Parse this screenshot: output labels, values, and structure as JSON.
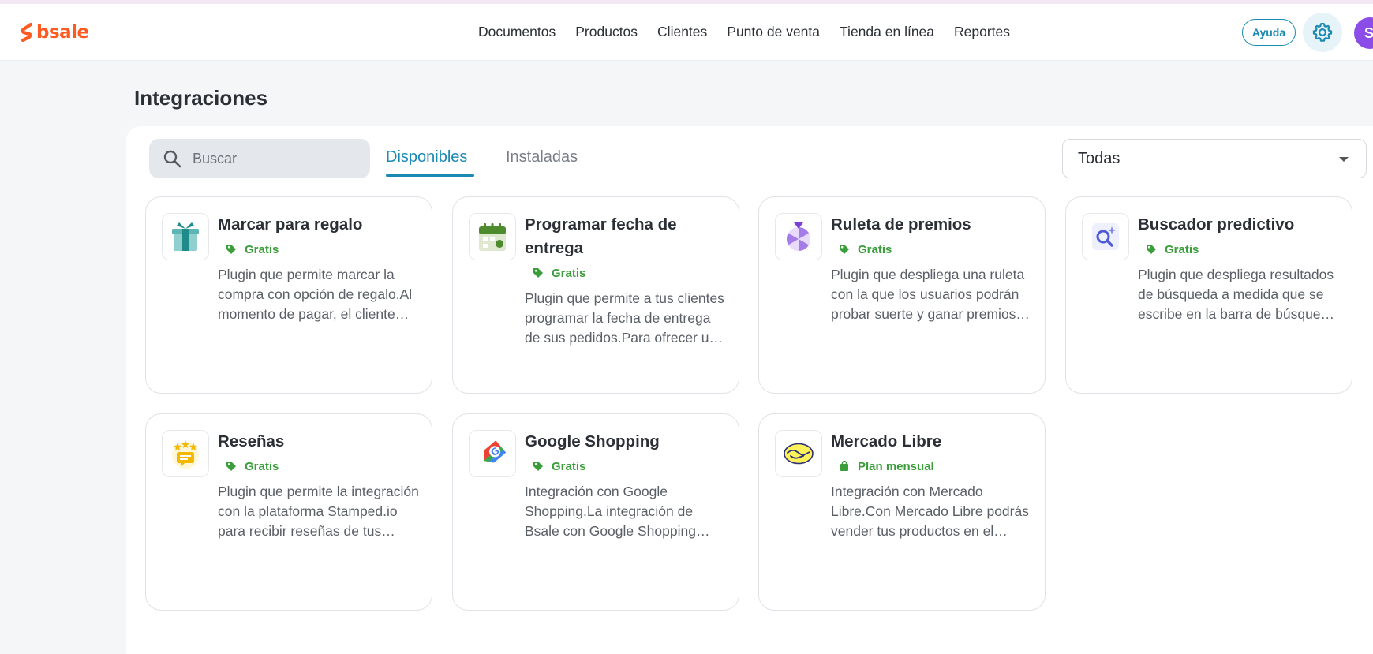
{
  "brand": {
    "logo_text": "bsale",
    "color": "#ff5a1f"
  },
  "nav": [
    {
      "label": "Documentos"
    },
    {
      "label": "Productos"
    },
    {
      "label": "Clientes"
    },
    {
      "label": "Punto de venta"
    },
    {
      "label": "Tienda en línea"
    },
    {
      "label": "Reportes"
    }
  ],
  "header": {
    "help_label": "Ayuda",
    "settings_icon": "gear-icon",
    "avatar_initial": "S"
  },
  "page": {
    "title": "Integraciones"
  },
  "search": {
    "placeholder": "Buscar",
    "value": ""
  },
  "tabs": [
    {
      "label": "Disponibles",
      "active": true
    },
    {
      "label": "Instaladas",
      "active": false
    }
  ],
  "filter": {
    "selected": "Todas"
  },
  "accent_color": "#1b8ab3",
  "price_color": "#3a9e3a",
  "cards": [
    {
      "title": "Marcar para regalo",
      "price": "Gratis",
      "price_icon": "tag-icon",
      "icon": "gift-icon",
      "description": "Plugin que permite marcar la compra con opción de regalo.Al momento de pagar, el cliente podrá indicar si desea que su compra sea enviada como regalo."
    },
    {
      "title": "Programar fecha de entrega",
      "price": "Gratis",
      "price_icon": "tag-icon",
      "icon": "calendar-icon",
      "description": "Plugin que permite a tus clientes programar la fecha de entrega de sus pedidos.Para ofrecer una mejor experiencia de compra."
    },
    {
      "title": "Ruleta de premios",
      "price": "Gratis",
      "price_icon": "tag-icon",
      "icon": "roulette-icon",
      "description": "Plugin que despliega una ruleta con la que los usuarios podrán probar suerte y ganar premios y descuentos."
    },
    {
      "title": "Buscador predictivo",
      "price": "Gratis",
      "price_icon": "tag-icon",
      "icon": "search-sparkle-icon",
      "description": "Plugin que despliega resultados de búsqueda a medida que se escribe en la barra de búsqueda de la tienda."
    },
    {
      "title": "Reseñas",
      "price": "Gratis",
      "price_icon": "tag-icon",
      "icon": "reviews-icon",
      "description": "Plugin que permite la integración con la plataforma Stamped.io para recibir reseñas de tus productos."
    },
    {
      "title": "Google Shopping",
      "price": "Gratis",
      "price_icon": "tag-icon",
      "icon": "google-shopping-icon",
      "description": "Integración con Google Shopping.La integración de Bsale con Google Shopping permite publicar tus productos."
    },
    {
      "title": "Mercado Libre",
      "price": "Plan mensual",
      "price_icon": "bag-icon",
      "icon": "mercado-libre-icon",
      "description": "Integración con Mercado Libre.Con Mercado Libre podrás vender tus productos en el marketplace más grande de la región."
    }
  ]
}
